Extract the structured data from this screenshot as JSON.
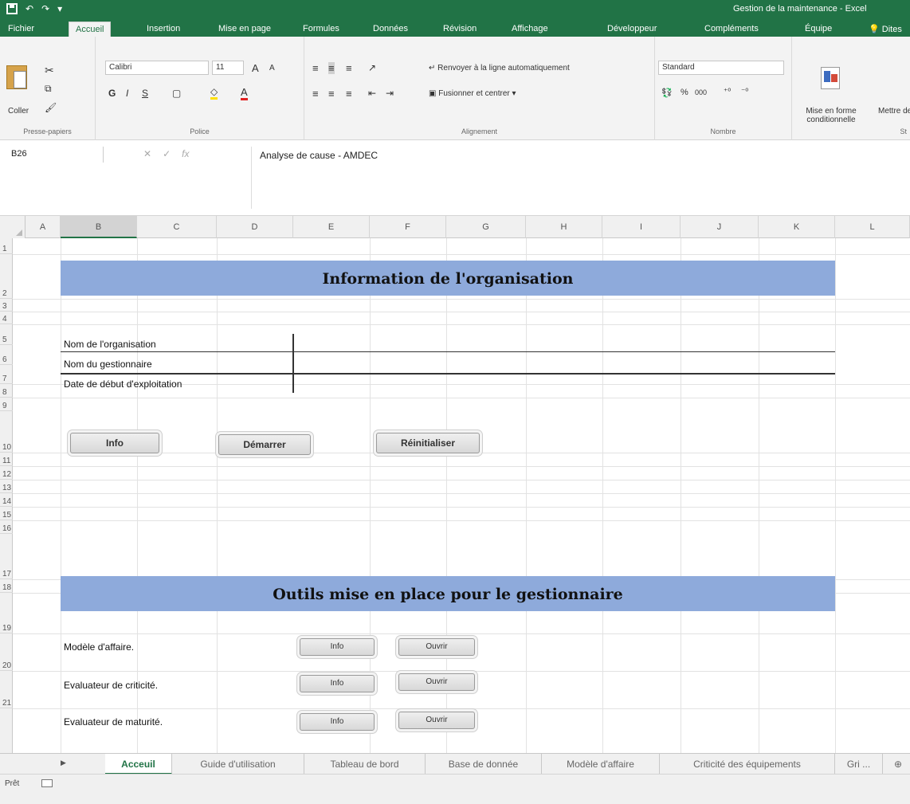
{
  "window": {
    "title": "Gestion de la maintenance - Excel"
  },
  "ribbon_tabs": [
    "Fichier",
    "Accueil",
    "Insertion",
    "Mise en page",
    "Formules",
    "Données",
    "Révision",
    "Affichage",
    "Développeur",
    "Compléments",
    "Équipe",
    "Dites"
  ],
  "active_tab": "Accueil",
  "ribbon": {
    "clipboard": {
      "paste_label": "Coller",
      "group_label": "Presse-papiers"
    },
    "font": {
      "name": "Calibri",
      "size": "11",
      "group_label": "Police",
      "bold": "G",
      "italic": "I",
      "underline": "S"
    },
    "alignment": {
      "wrap_label": "Renvoyer à la ligne automatiquement",
      "merge_label": "Fusionner et centrer",
      "group_label": "Alignement"
    },
    "number": {
      "format": "Standard",
      "percent": "%",
      "thousands": "000",
      "group_label": "Nombre"
    },
    "styles": {
      "cond_format_label": "Mise en forme conditionnelle",
      "table_label": "Mettre de",
      "group_label": "St"
    }
  },
  "formula_bar": {
    "name_box": "B26",
    "content": "Analyse de cause - AMDEC",
    "cancel": "✕",
    "enter": "✓",
    "fx": "fx"
  },
  "columns": [
    "A",
    "B",
    "C",
    "D",
    "E",
    "F",
    "G",
    "H",
    "I",
    "J",
    "K",
    "L"
  ],
  "selected_column": "B",
  "rows": [
    "1",
    "2",
    "3",
    "4",
    "5",
    "6",
    "7",
    "8",
    "9",
    "10",
    "11",
    "12",
    "13",
    "14",
    "15",
    "16",
    "17",
    "18",
    "19",
    "20",
    "21"
  ],
  "sheet": {
    "section1_title": "Information de l'organisation",
    "fields": [
      "Nom de l'organisation",
      "Nom du gestionnaire",
      "Date de début d'exploitation"
    ],
    "buttons1": {
      "info": "Info",
      "start": "Démarrer",
      "reset": "Réinitialiser"
    },
    "section2_title": "Outils mise en place pour le gestionnaire",
    "tools": [
      {
        "label": "Modèle d'affaire.",
        "info": "Info",
        "open": "Ouvrir"
      },
      {
        "label": "Evaluateur de criticité.",
        "info": "Info",
        "open": "Ouvrir"
      },
      {
        "label": "Evaluateur de maturité.",
        "info": "Info",
        "open": "Ouvrir"
      }
    ]
  },
  "sheet_tabs": [
    "Acceuil",
    "Guide d'utilisation",
    "Tableau de bord",
    "Base de donnée",
    "Modèle d'affaire",
    "Criticité des équipements",
    "Gri ..."
  ],
  "active_sheet": "Acceuil",
  "status": {
    "text": "Prêt"
  }
}
